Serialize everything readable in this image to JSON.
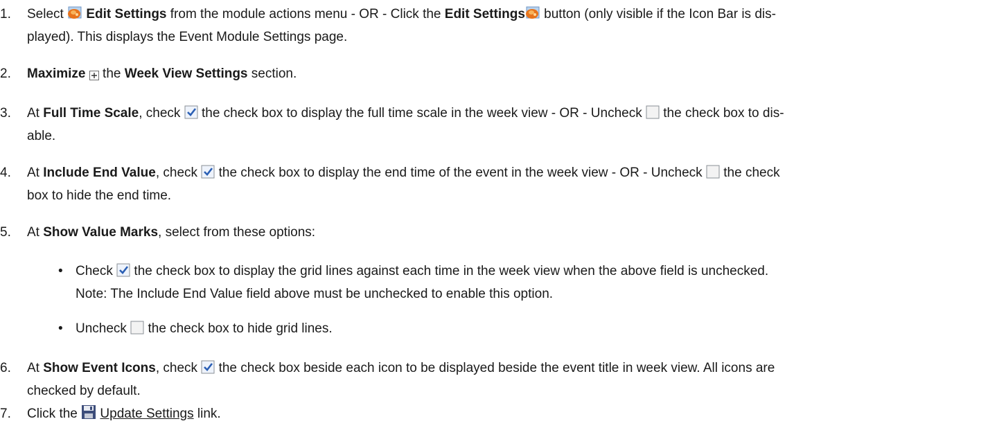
{
  "steps": [
    {
      "num": "1.",
      "a": "Select ",
      "b1": "Edit Settings",
      "c": " from the module actions menu - OR - Click the ",
      "b2": "Edit Settings",
      "d": " button (only visible if the Icon Bar is dis-",
      "e": "played). This displays the Event Module Settings page."
    },
    {
      "num": "2.",
      "b1": "Maximize",
      "a": " the ",
      "b2": "Week View Settings",
      "c": " section."
    },
    {
      "num": "3.",
      "a": "At ",
      "b1": "Full Time Scale",
      "c": ", check ",
      "d": " the check box to display the full time scale in the week view - OR - Uncheck ",
      "e": " the check box to dis-",
      "f": "able."
    },
    {
      "num": "4.",
      "a": "At ",
      "b1": "Include End Value",
      "c": ", check ",
      "d": " the check box to display the end time of the event in the week view - OR - Uncheck ",
      "e": " the check",
      "f": "box to hide the end time."
    },
    {
      "num": "5.",
      "a": "At ",
      "b1": "Show Value Marks",
      "c": ", select from these options:"
    },
    {
      "num": "6.",
      "a": "At ",
      "b1": "Show Event Icons",
      "c": ", check ",
      "d": " the check box beside each icon to be displayed beside the event title in week view. All icons are",
      "e": "checked by default."
    },
    {
      "num": "7.",
      "a": "Click the ",
      "link": "Update Settings",
      "c": " link."
    }
  ],
  "bullets": [
    {
      "dot": "•",
      "a": "Check ",
      "b": " the check box to display the grid lines against each time in the week view when the above field is unchecked.",
      "c": "Note: The Include End Value field above must be unchecked to enable this option."
    },
    {
      "dot": "•",
      "a": "Uncheck ",
      "b": " the check box to hide grid lines."
    }
  ],
  "icons": {
    "edit_settings": "edit-settings-icon",
    "maximize": "maximize-icon",
    "checked": "checked-checkbox-icon",
    "unchecked": "unchecked-checkbox-icon",
    "save": "save-icon"
  },
  "colors": {
    "text": "#1a1a1a",
    "checkbox_check": "#2b5fb4",
    "edit_icon_orange": "#e8741c"
  }
}
